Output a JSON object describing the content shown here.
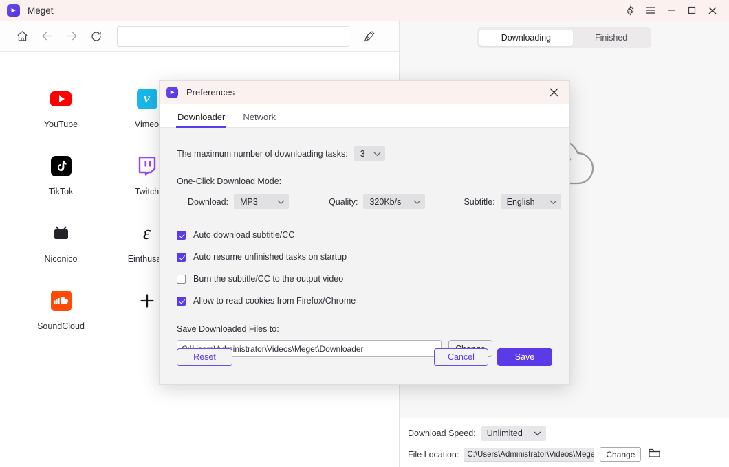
{
  "window": {
    "app_title": "Meget",
    "logo_glyph": "▸",
    "controls": [
      {
        "name": "settings-gear",
        "label": "gear-icon"
      },
      {
        "name": "menu",
        "label": "hamburger-icon"
      },
      {
        "name": "minimize",
        "label": "minimize-icon"
      },
      {
        "name": "maximize",
        "label": "maximize-icon"
      },
      {
        "name": "close",
        "label": "close-icon"
      }
    ]
  },
  "browser": {
    "nav": {
      "home": "home-icon",
      "back": "arrow-left-icon",
      "forward": "arrow-right-icon",
      "reload": "reload-icon",
      "clean": "broom-icon"
    },
    "url_value": "",
    "url_placeholder": "",
    "sites": [
      {
        "label": "YouTube",
        "icon": "youtube-icon"
      },
      {
        "label": "Vimeo",
        "icon": "vimeo-icon"
      },
      {
        "label": "TikTok",
        "icon": "tiktok-icon"
      },
      {
        "label": "Twitch",
        "icon": "twitch-icon"
      },
      {
        "label": "Niconico",
        "icon": "niconico-icon"
      },
      {
        "label": "Einthusan",
        "icon": "einthusan-icon"
      },
      {
        "label": "SoundCloud",
        "icon": "soundcloud-icon"
      },
      {
        "label": "",
        "icon": "plus-icon"
      }
    ]
  },
  "downloads": {
    "tabs": [
      {
        "label": "Downloading",
        "active": true
      },
      {
        "label": "Finished",
        "active": false
      }
    ],
    "empty_illustration": "cloud-icon",
    "bottom": {
      "speed_label": "Download Speed:",
      "speed_value": "Unlimited",
      "location_label": "File Location:",
      "location_value": "C:\\Users\\Administrator\\Videos\\Meget\\D",
      "change_label": "Change",
      "folder_icon": "folder-icon"
    }
  },
  "dialog": {
    "title": "Preferences",
    "close_icon": "close-icon",
    "tabs": [
      {
        "label": "Downloader",
        "active": true
      },
      {
        "label": "Network",
        "active": false
      }
    ],
    "max_tasks": {
      "label": "The maximum number of downloading tasks:",
      "value": "3"
    },
    "one_click": {
      "section_label": "One-Click Download Mode:",
      "download_label": "Download:",
      "download_value": "MP3",
      "quality_label": "Quality:",
      "quality_value": "320Kb/s",
      "subtitle_label": "Subtitle:",
      "subtitle_value": "English"
    },
    "checkboxes": [
      {
        "label": "Auto download subtitle/CC",
        "checked": true
      },
      {
        "label": "Auto resume unfinished tasks on startup",
        "checked": true
      },
      {
        "label": "Burn the subtitle/CC to the output video",
        "checked": false
      },
      {
        "label": "Allow to read cookies from Firefox/Chrome",
        "checked": true
      }
    ],
    "save_path": {
      "label": "Save Downloaded Files to:",
      "value": "C:\\Users\\Administrator\\Videos\\Meget\\Downloader",
      "change_label": "Change"
    },
    "buttons": {
      "reset": "Reset",
      "cancel": "Cancel",
      "save": "Save"
    }
  },
  "colors": {
    "accent": "#5b3ae8",
    "titlebar": "#fbf1ef",
    "panel": "#f3f3f3",
    "youtube": "#ff0000",
    "vimeo": "#19b7ea",
    "twitch": "#9146ff",
    "soundcloud": "#ff4b07"
  }
}
